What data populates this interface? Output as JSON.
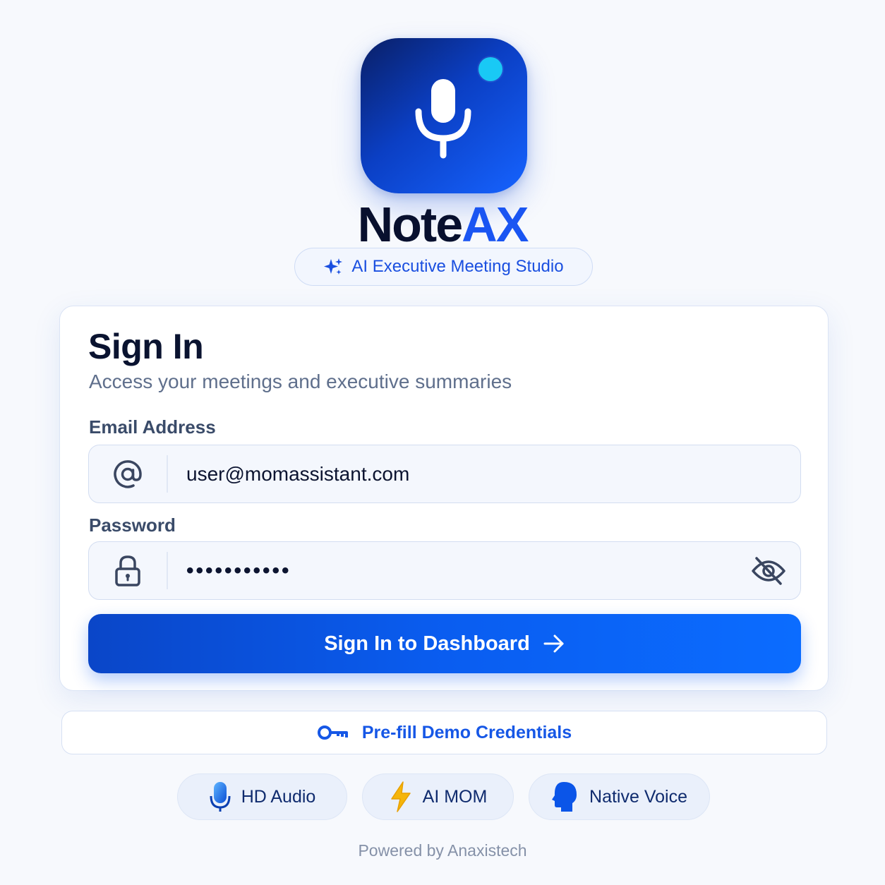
{
  "brand": {
    "name_part1": "Note",
    "name_part2": "AX",
    "tagline": "AI Executive Meeting Studio",
    "icon": "microphone-icon"
  },
  "signin": {
    "title": "Sign In",
    "subtitle": "Access your meetings and executive summaries",
    "email": {
      "label": "Email Address",
      "value": "user@momassistant.com",
      "icon": "at-icon"
    },
    "password": {
      "label": "Password",
      "masked_value": "•••••••••••",
      "icon": "lock-icon",
      "toggle_icon": "eye-off-icon"
    },
    "submit_label": "Sign In to Dashboard"
  },
  "demo": {
    "label": "Pre-fill Demo Credentials",
    "icon": "key-icon"
  },
  "features": [
    {
      "label": "HD Audio",
      "icon": "microphone-icon"
    },
    {
      "label": "AI MOM",
      "icon": "lightning-icon"
    },
    {
      "label": "Native Voice",
      "icon": "speaking-head-icon"
    }
  ],
  "footer": {
    "powered_by": "Powered by Anaxistech"
  },
  "colors": {
    "primary": "#0b5ef5",
    "brand_dark": "#08102e",
    "brand_accent": "#1a55f2",
    "status_dot": "#19c9f5"
  }
}
